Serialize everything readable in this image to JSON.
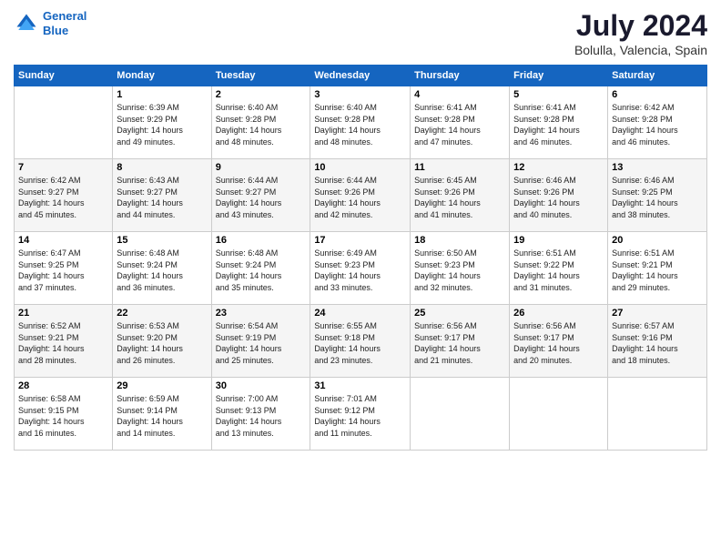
{
  "header": {
    "logo_line1": "General",
    "logo_line2": "Blue",
    "title": "July 2024",
    "subtitle": "Bolulla, Valencia, Spain"
  },
  "calendar": {
    "days_of_week": [
      "Sunday",
      "Monday",
      "Tuesday",
      "Wednesday",
      "Thursday",
      "Friday",
      "Saturday"
    ],
    "weeks": [
      [
        {
          "day": "",
          "info": ""
        },
        {
          "day": "1",
          "info": "Sunrise: 6:39 AM\nSunset: 9:29 PM\nDaylight: 14 hours\nand 49 minutes."
        },
        {
          "day": "2",
          "info": "Sunrise: 6:40 AM\nSunset: 9:28 PM\nDaylight: 14 hours\nand 48 minutes."
        },
        {
          "day": "3",
          "info": "Sunrise: 6:40 AM\nSunset: 9:28 PM\nDaylight: 14 hours\nand 48 minutes."
        },
        {
          "day": "4",
          "info": "Sunrise: 6:41 AM\nSunset: 9:28 PM\nDaylight: 14 hours\nand 47 minutes."
        },
        {
          "day": "5",
          "info": "Sunrise: 6:41 AM\nSunset: 9:28 PM\nDaylight: 14 hours\nand 46 minutes."
        },
        {
          "day": "6",
          "info": "Sunrise: 6:42 AM\nSunset: 9:28 PM\nDaylight: 14 hours\nand 46 minutes."
        }
      ],
      [
        {
          "day": "7",
          "info": "Sunrise: 6:42 AM\nSunset: 9:27 PM\nDaylight: 14 hours\nand 45 minutes."
        },
        {
          "day": "8",
          "info": "Sunrise: 6:43 AM\nSunset: 9:27 PM\nDaylight: 14 hours\nand 44 minutes."
        },
        {
          "day": "9",
          "info": "Sunrise: 6:44 AM\nSunset: 9:27 PM\nDaylight: 14 hours\nand 43 minutes."
        },
        {
          "day": "10",
          "info": "Sunrise: 6:44 AM\nSunset: 9:26 PM\nDaylight: 14 hours\nand 42 minutes."
        },
        {
          "day": "11",
          "info": "Sunrise: 6:45 AM\nSunset: 9:26 PM\nDaylight: 14 hours\nand 41 minutes."
        },
        {
          "day": "12",
          "info": "Sunrise: 6:46 AM\nSunset: 9:26 PM\nDaylight: 14 hours\nand 40 minutes."
        },
        {
          "day": "13",
          "info": "Sunrise: 6:46 AM\nSunset: 9:25 PM\nDaylight: 14 hours\nand 38 minutes."
        }
      ],
      [
        {
          "day": "14",
          "info": "Sunrise: 6:47 AM\nSunset: 9:25 PM\nDaylight: 14 hours\nand 37 minutes."
        },
        {
          "day": "15",
          "info": "Sunrise: 6:48 AM\nSunset: 9:24 PM\nDaylight: 14 hours\nand 36 minutes."
        },
        {
          "day": "16",
          "info": "Sunrise: 6:48 AM\nSunset: 9:24 PM\nDaylight: 14 hours\nand 35 minutes."
        },
        {
          "day": "17",
          "info": "Sunrise: 6:49 AM\nSunset: 9:23 PM\nDaylight: 14 hours\nand 33 minutes."
        },
        {
          "day": "18",
          "info": "Sunrise: 6:50 AM\nSunset: 9:23 PM\nDaylight: 14 hours\nand 32 minutes."
        },
        {
          "day": "19",
          "info": "Sunrise: 6:51 AM\nSunset: 9:22 PM\nDaylight: 14 hours\nand 31 minutes."
        },
        {
          "day": "20",
          "info": "Sunrise: 6:51 AM\nSunset: 9:21 PM\nDaylight: 14 hours\nand 29 minutes."
        }
      ],
      [
        {
          "day": "21",
          "info": "Sunrise: 6:52 AM\nSunset: 9:21 PM\nDaylight: 14 hours\nand 28 minutes."
        },
        {
          "day": "22",
          "info": "Sunrise: 6:53 AM\nSunset: 9:20 PM\nDaylight: 14 hours\nand 26 minutes."
        },
        {
          "day": "23",
          "info": "Sunrise: 6:54 AM\nSunset: 9:19 PM\nDaylight: 14 hours\nand 25 minutes."
        },
        {
          "day": "24",
          "info": "Sunrise: 6:55 AM\nSunset: 9:18 PM\nDaylight: 14 hours\nand 23 minutes."
        },
        {
          "day": "25",
          "info": "Sunrise: 6:56 AM\nSunset: 9:17 PM\nDaylight: 14 hours\nand 21 minutes."
        },
        {
          "day": "26",
          "info": "Sunrise: 6:56 AM\nSunset: 9:17 PM\nDaylight: 14 hours\nand 20 minutes."
        },
        {
          "day": "27",
          "info": "Sunrise: 6:57 AM\nSunset: 9:16 PM\nDaylight: 14 hours\nand 18 minutes."
        }
      ],
      [
        {
          "day": "28",
          "info": "Sunrise: 6:58 AM\nSunset: 9:15 PM\nDaylight: 14 hours\nand 16 minutes."
        },
        {
          "day": "29",
          "info": "Sunrise: 6:59 AM\nSunset: 9:14 PM\nDaylight: 14 hours\nand 14 minutes."
        },
        {
          "day": "30",
          "info": "Sunrise: 7:00 AM\nSunset: 9:13 PM\nDaylight: 14 hours\nand 13 minutes."
        },
        {
          "day": "31",
          "info": "Sunrise: 7:01 AM\nSunset: 9:12 PM\nDaylight: 14 hours\nand 11 minutes."
        },
        {
          "day": "",
          "info": ""
        },
        {
          "day": "",
          "info": ""
        },
        {
          "day": "",
          "info": ""
        }
      ]
    ]
  }
}
